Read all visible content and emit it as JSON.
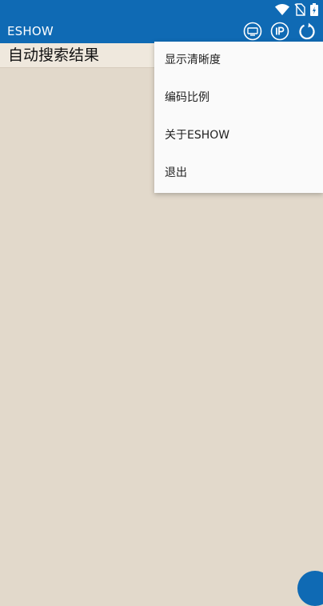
{
  "app": {
    "title": "ESHOW"
  },
  "status_bar": {
    "icons": [
      "wifi-icon",
      "no-sim-icon",
      "battery-charging-icon"
    ]
  },
  "toolbar": {
    "actions": [
      "screen-icon",
      "ip-icon",
      "refresh-icon"
    ]
  },
  "content": {
    "header": "自动搜索结果"
  },
  "menu": {
    "items": [
      {
        "label": "显示清晰度"
      },
      {
        "label": "编码比例"
      },
      {
        "label": "关于ESHOW"
      },
      {
        "label": "退出"
      }
    ]
  },
  "colors": {
    "primary": "#0f6ab4",
    "background": "#e2d9cb",
    "header_background": "#efe8dd",
    "menu_background": "#fafafa"
  }
}
